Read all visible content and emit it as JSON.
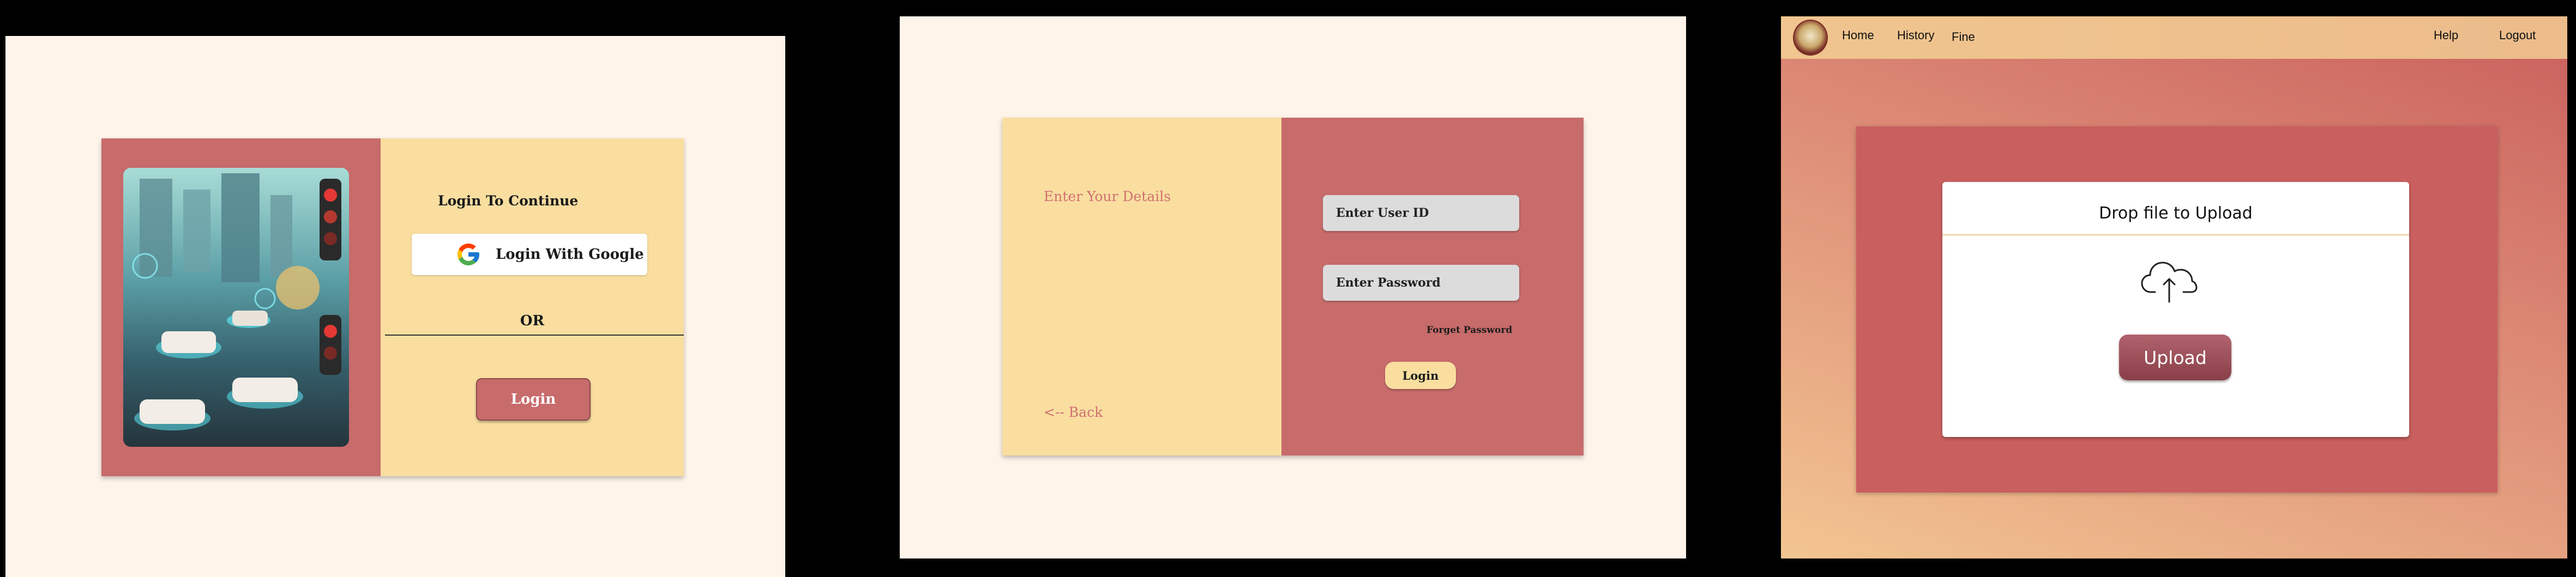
{
  "login_page": {
    "title": "Login To Continue",
    "google_button": "Login With Google",
    "or_text": "OR",
    "login_button": "Login"
  },
  "details_page": {
    "heading": "Enter Your Details",
    "user_id_placeholder": "Enter User ID",
    "password_placeholder": "Enter Password",
    "forgot_password": "Forget Password",
    "login_button": "Login",
    "back_link": "<-- Back"
  },
  "upload_page": {
    "nav": {
      "home": "Home",
      "history": "History",
      "fine": "Fine",
      "help": "Help",
      "logout": "Logout"
    },
    "drop_title": "Drop file to Upload",
    "upload_button": "Upload",
    "icons": [
      "logo-emblem",
      "cloud-upload-icon"
    ]
  },
  "colors": {
    "panel_bg": "#fef4ea",
    "rose": "#c76b6b",
    "cream": "#f9dea0",
    "upload_button": "#8a3f48"
  }
}
